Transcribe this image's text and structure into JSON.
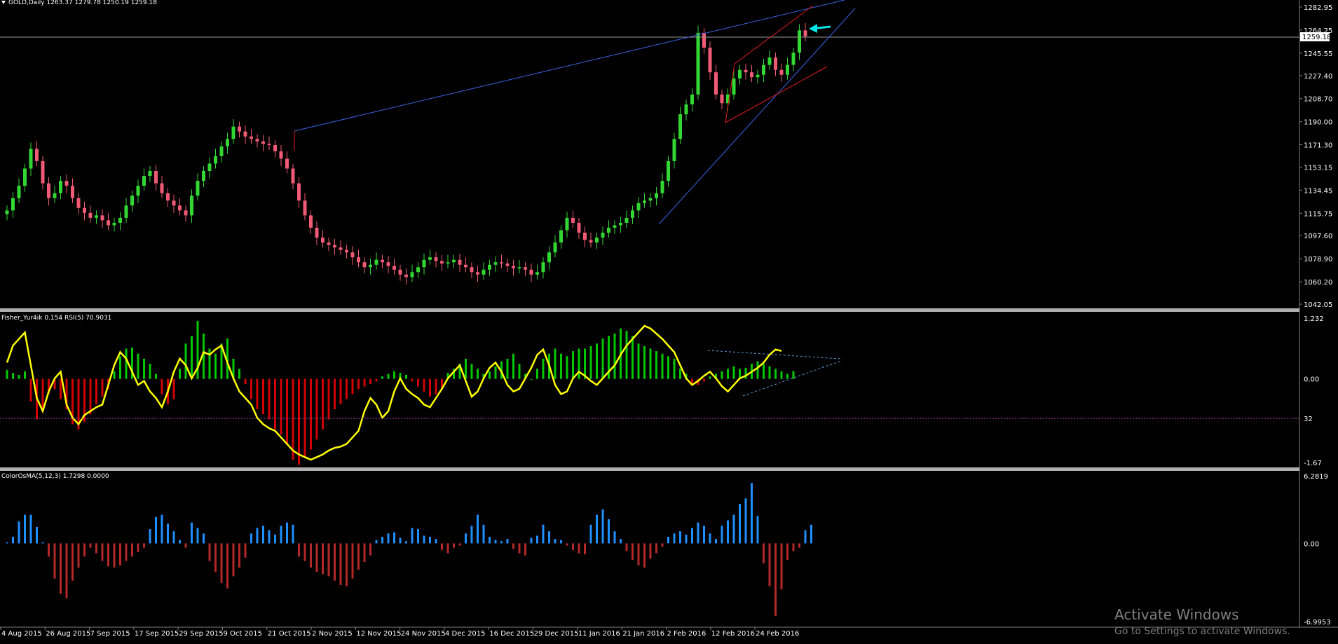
{
  "colors": {
    "background": "#000000",
    "bull": "#32d732",
    "bear": "#f05a74",
    "trend_blue": "#3c64e6",
    "trend_red": "#e01c1c",
    "fisher_green": "#00c800",
    "fisher_red": "#d20000",
    "rsi_line": "#ffff00",
    "osma_up": "#1e90ff",
    "osma_down": "#b42828",
    "arrow": "#00e5e5"
  },
  "main": {
    "title": "GOLD,Daily  1263.37 1279.78 1250.19 1259.18",
    "price_ticks": [
      "1282.95",
      "1264.25",
      "1245.55",
      "1227.40",
      "1208.70",
      "1190.00",
      "1171.30",
      "1153.15",
      "1134.45",
      "1115.75",
      "1097.60",
      "1078.90",
      "1060.20",
      "1042.05"
    ],
    "current_price": "1259.18",
    "current_value": 1259.18,
    "y_range": [
      1042.05,
      1282.95
    ]
  },
  "fisher": {
    "title": "Fisher_Yur4ik 0.154  RSI(5) 70.9031",
    "ticks": [
      "1.232",
      "0.00",
      "32",
      "-1.67"
    ],
    "range": [
      -1.67,
      1.232
    ]
  },
  "osma": {
    "title": "ColorOsMA(5,12,3) 1.7298 0.0000",
    "ticks": [
      "6.2819",
      "0.00",
      "-6.9953"
    ],
    "range": [
      -6.9953,
      6.2819
    ]
  },
  "x_labels": [
    "4 Aug 2015",
    "26 Aug 2015",
    "7 Sep 2015",
    "17 Sep 2015",
    "29 Sep 2015",
    "9 Oct 2015",
    "21 Oct 2015",
    "2 Nov 2015",
    "12 Nov 2015",
    "24 Nov 2015",
    "4 Dec 2015",
    "16 Dec 2015",
    "29 Dec 2015",
    "11 Jan 2016",
    "21 Jan 2016",
    "2 Feb 2016",
    "12 Feb 2016",
    "24 Feb 2016"
  ],
  "watermark": {
    "line1": "Activate Windows",
    "line2": "Go to Settings to activate Windows."
  },
  "chart_data": [
    {
      "type": "candlestick",
      "name": "GOLD,Daily",
      "close_path": [
        1118,
        1128,
        1138,
        1152,
        1168,
        1158,
        1140,
        1128,
        1132,
        1142,
        1138,
        1128,
        1120,
        1116,
        1112,
        1114,
        1110,
        1106,
        1108,
        1112,
        1122,
        1130,
        1138,
        1146,
        1150,
        1140,
        1132,
        1126,
        1122,
        1118,
        1114,
        1130,
        1142,
        1150,
        1156,
        1162,
        1170,
        1176,
        1186,
        1182,
        1178,
        1176,
        1174,
        1172,
        1171,
        1166,
        1160,
        1152,
        1140,
        1126,
        1114,
        1104,
        1096,
        1092,
        1090,
        1088,
        1086,
        1084,
        1080,
        1076,
        1072,
        1074,
        1078,
        1076,
        1073,
        1070,
        1066,
        1064,
        1068,
        1072,
        1078,
        1080,
        1077,
        1075,
        1076,
        1078,
        1074,
        1072,
        1068,
        1066,
        1070,
        1074,
        1076,
        1075,
        1073,
        1071,
        1072,
        1070,
        1066,
        1068,
        1076,
        1084,
        1092,
        1102,
        1112,
        1108,
        1100,
        1094,
        1092,
        1096,
        1100,
        1104,
        1106,
        1108,
        1112,
        1118,
        1124,
        1126,
        1128,
        1132,
        1142,
        1158,
        1176,
        1196,
        1204,
        1212,
        1262,
        1250,
        1230,
        1212,
        1205,
        1212,
        1225,
        1232,
        1230,
        1226,
        1228,
        1236,
        1242,
        1232,
        1228,
        1236,
        1246,
        1264,
        1259.18
      ]
    },
    {
      "type": "bar",
      "name": "Fisher_Yur4ik",
      "values": [
        0.18,
        0.12,
        0.08,
        0.15,
        -0.45,
        -0.8,
        -0.6,
        -0.3,
        -0.2,
        -0.4,
        -0.6,
        -0.9,
        -1.0,
        -0.85,
        -0.7,
        -0.5,
        -0.35,
        -0.2,
        0.15,
        0.45,
        0.6,
        0.62,
        0.5,
        0.4,
        0.3,
        0.1,
        -0.3,
        -0.5,
        -0.4,
        0.2,
        0.7,
        0.85,
        1.15,
        0.9,
        0.6,
        0.5,
        0.7,
        0.8,
        0.4,
        0.2,
        -0.1,
        -0.4,
        -0.6,
        -0.7,
        -0.8,
        -1.0,
        -1.1,
        -1.3,
        -1.6,
        -1.7,
        -1.55,
        -1.4,
        -1.2,
        -1.0,
        -0.8,
        -0.6,
        -0.5,
        -0.4,
        -0.3,
        -0.2,
        -0.15,
        -0.1,
        -0.05,
        0.05,
        0.1,
        0.15,
        0.12,
        0.08,
        -0.05,
        -0.15,
        -0.25,
        -0.35,
        -0.3,
        -0.2,
        0.12,
        0.2,
        0.3,
        0.4,
        0.3,
        0.2,
        0.1,
        0.15,
        0.25,
        0.35,
        0.4,
        0.5,
        0.3,
        0.1,
        0.0,
        0.2,
        0.4,
        0.5,
        0.6,
        0.5,
        0.45,
        0.55,
        0.6,
        0.6,
        0.65,
        0.7,
        0.8,
        0.85,
        0.9,
        1.0,
        0.95,
        0.85,
        0.7,
        0.65,
        0.6,
        0.55,
        0.5,
        0.45,
        0.4,
        0.2,
        0.1,
        -0.1,
        -0.12,
        -0.05,
        0.05,
        0.1,
        0.15,
        0.2,
        0.25,
        0.2,
        0.22,
        0.3,
        0.35,
        0.3,
        0.25,
        0.2,
        0.15,
        0.1,
        0.154
      ]
    },
    {
      "type": "line",
      "name": "RSI(5)",
      "values": [
        62,
        75,
        80,
        85,
        60,
        35,
        25,
        40,
        50,
        55,
        30,
        20,
        15,
        22,
        25,
        28,
        30,
        45,
        60,
        70,
        65,
        55,
        45,
        48,
        40,
        35,
        28,
        40,
        55,
        65,
        60,
        50,
        58,
        70,
        68,
        72,
        75,
        62,
        50,
        40,
        35,
        30,
        20,
        15,
        12,
        10,
        5,
        0,
        -5,
        -8,
        -10,
        -12,
        -10,
        -8,
        -5,
        -3,
        -2,
        0,
        5,
        10,
        25,
        35,
        30,
        20,
        25,
        40,
        50,
        42,
        38,
        35,
        30,
        28,
        35,
        42,
        50,
        55,
        60,
        48,
        36,
        40,
        50,
        58,
        62,
        55,
        45,
        40,
        42,
        50,
        58,
        68,
        72,
        60,
        45,
        38,
        40,
        50,
        55,
        52,
        48,
        45,
        50,
        55,
        60,
        68,
        75,
        80,
        85,
        90,
        88,
        84,
        80,
        75,
        70,
        60,
        50,
        45,
        48,
        52,
        55,
        50,
        44,
        40,
        45,
        50,
        52,
        55,
        58,
        62,
        68,
        72,
        70.9
      ]
    },
    {
      "type": "bar",
      "name": "ColorOsMA(5,12,3)",
      "values": [
        0.1,
        0.6,
        2.0,
        2.6,
        2.6,
        1.5,
        0.1,
        -1.2,
        -3.2,
        -4.6,
        -5.0,
        -3.4,
        -2.2,
        -1.2,
        -0.4,
        -0.9,
        -1.6,
        -2.1,
        -2.2,
        -2.0,
        -1.6,
        -1.2,
        -0.8,
        -0.4,
        1.3,
        2.4,
        2.6,
        1.8,
        1.1,
        0.3,
        -0.4,
        1.9,
        1.4,
        0.9,
        -1.6,
        -2.6,
        -3.6,
        -4.1,
        -3.0,
        -2.2,
        -1.3,
        0.9,
        1.4,
        1.6,
        1.2,
        0.8,
        1.6,
        1.9,
        1.7,
        -1.2,
        -1.6,
        -2.2,
        -2.6,
        -2.8,
        -3.0,
        -3.4,
        -3.8,
        -3.9,
        -3.2,
        -2.4,
        -1.7,
        -1.1,
        0.3,
        0.6,
        0.9,
        1.0,
        0.5,
        0.2,
        1.4,
        1.3,
        0.7,
        0.6,
        0.4,
        -0.6,
        -0.9,
        -0.4,
        -0.2,
        0.9,
        1.6,
        2.6,
        1.7,
        0.6,
        0.3,
        0.2,
        0.4,
        -0.5,
        -0.9,
        -1.1,
        0.5,
        0.7,
        1.7,
        1.1,
        0.4,
        0.3,
        -0.2,
        -0.6,
        -0.9,
        -1.0,
        1.7,
        2.6,
        3.1,
        2.2,
        1.1,
        0.4,
        -0.7,
        -1.5,
        -2.0,
        -2.2,
        -1.4,
        -0.9,
        -0.3,
        0.6,
        0.9,
        1.1,
        0.8,
        1.4,
        1.9,
        1.6,
        0.9,
        0.4,
        1.6,
        2.1,
        2.6,
        3.6,
        4.1,
        5.5,
        2.5,
        -1.8,
        -3.9,
        -6.6,
        -4.2,
        -1.5,
        -0.7,
        -0.4,
        1.2,
        1.7
      ]
    }
  ]
}
